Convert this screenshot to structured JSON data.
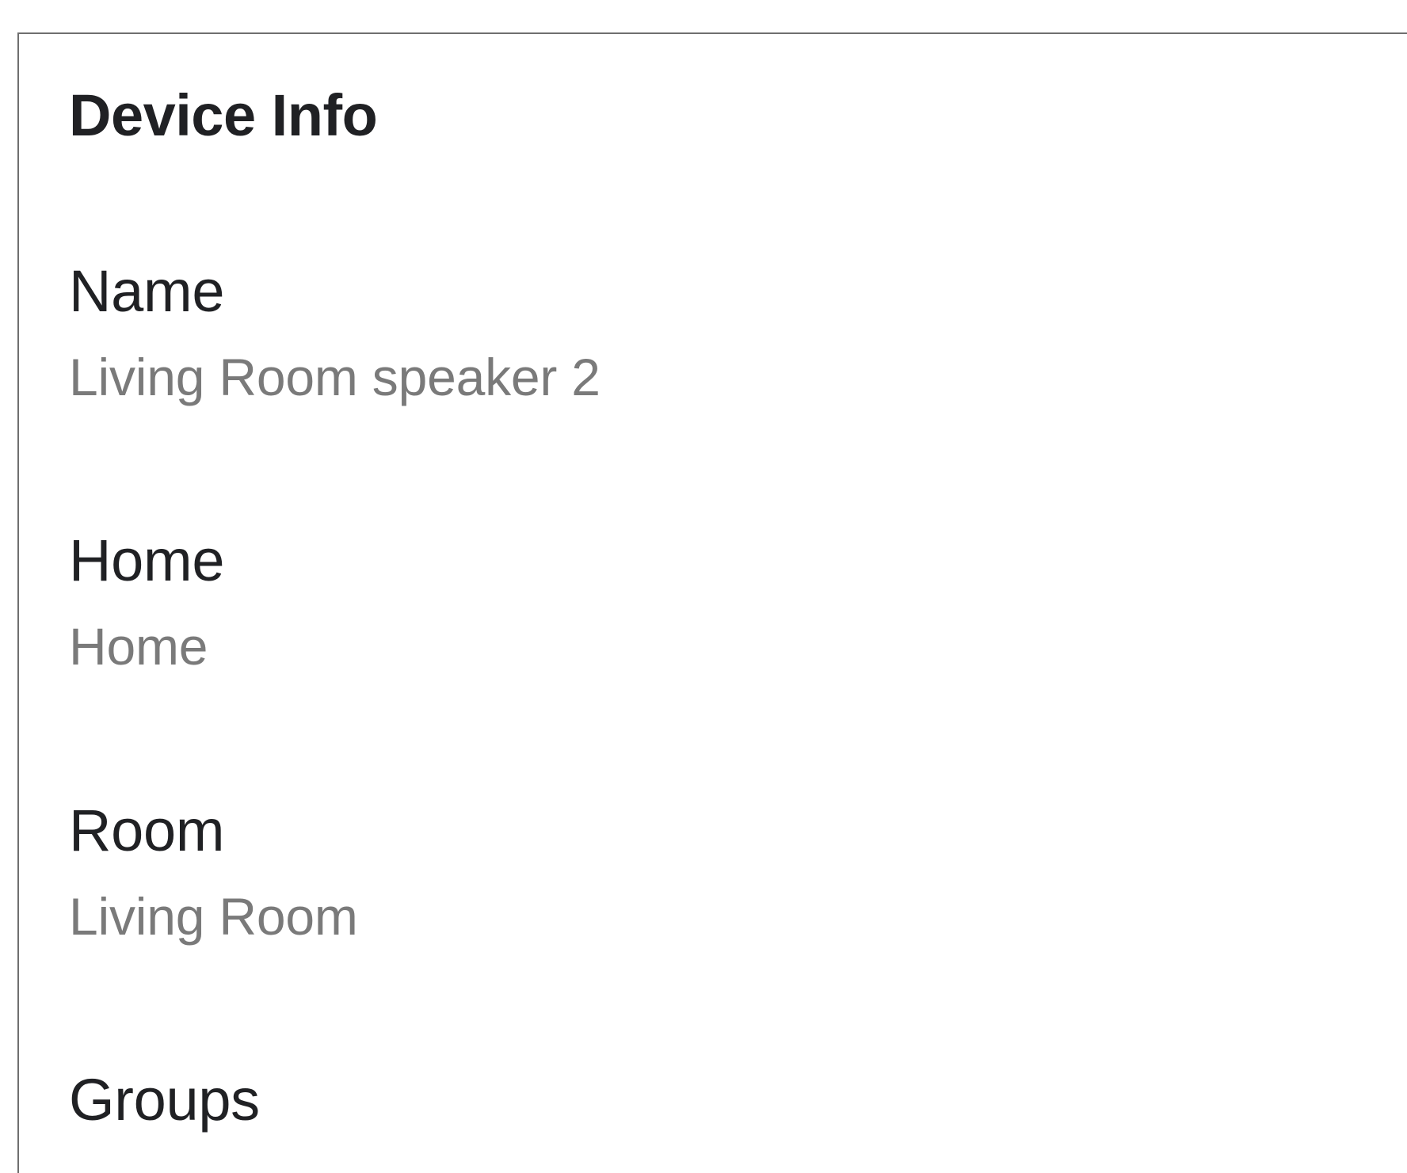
{
  "section": {
    "title": "Device Info"
  },
  "rows": [
    {
      "label": "Name",
      "value": "Living Room speaker 2"
    },
    {
      "label": "Home",
      "value": "Home"
    },
    {
      "label": "Room",
      "value": "Living Room"
    },
    {
      "label": "Groups",
      "value": ""
    }
  ]
}
